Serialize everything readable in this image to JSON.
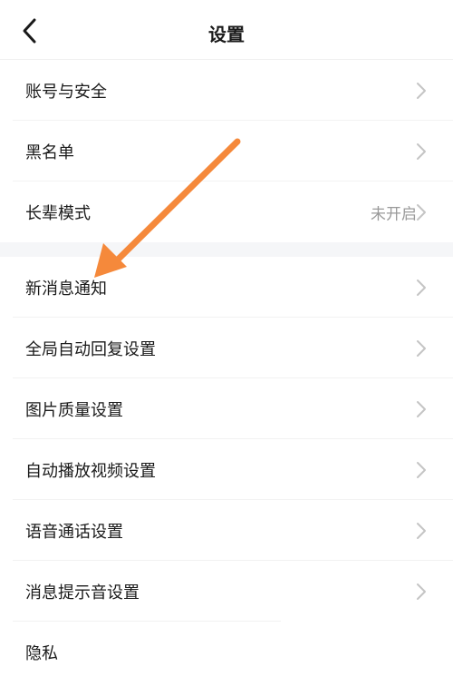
{
  "header": {
    "title": "设置",
    "back_icon": "chevron-left-icon"
  },
  "group1": {
    "items": [
      {
        "label": "账号与安全"
      },
      {
        "label": "黑名单"
      },
      {
        "label": "长辈模式",
        "value": "未开启"
      }
    ]
  },
  "group2": {
    "items": [
      {
        "label": "新消息通知"
      },
      {
        "label": "全局自动回复设置"
      },
      {
        "label": "图片质量设置"
      },
      {
        "label": "自动播放视频设置"
      },
      {
        "label": "语音通话设置"
      },
      {
        "label": "消息提示音设置"
      },
      {
        "label": "隐私"
      }
    ]
  },
  "annotation": {
    "arrow_color": "#f5893b"
  }
}
